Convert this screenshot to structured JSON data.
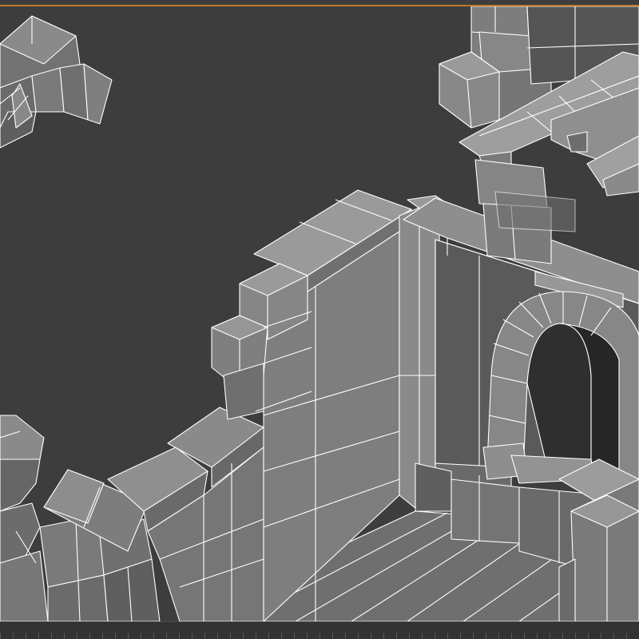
{
  "app": {
    "title": ""
  },
  "viewport": {
    "render_mode": "shaded-with-wireframe",
    "background_color": "#3d3d3d",
    "wire_color": "#ffffff",
    "frame_accent_color": "#c07a28",
    "subject": "ruined-stone-building-model"
  }
}
